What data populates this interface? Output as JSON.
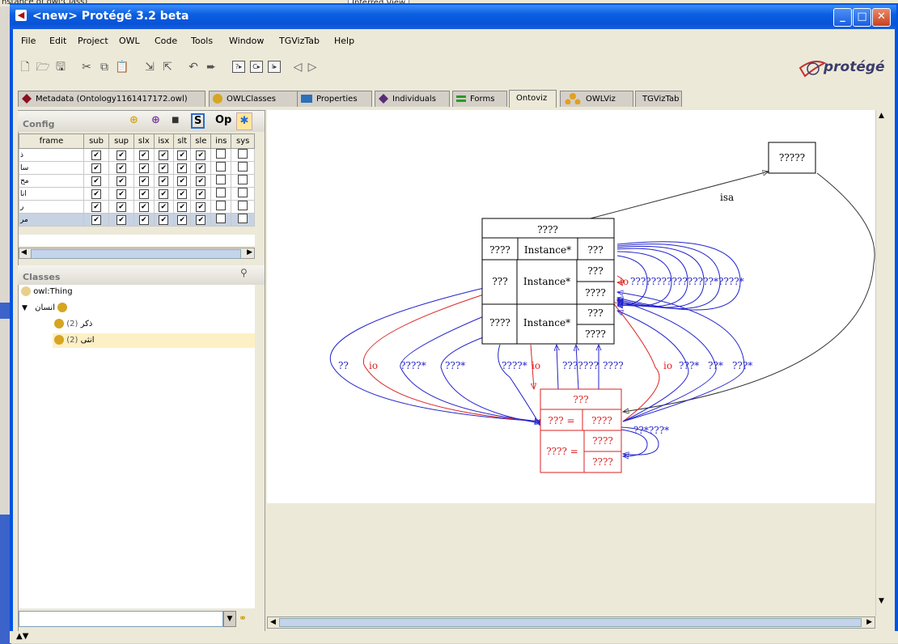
{
  "window": {
    "title": "<new>  Protégé 3.2 beta"
  },
  "background": {
    "left_text": "nstance of owl:Class)",
    "right_text": "Inferred View"
  },
  "menu": [
    "File",
    "Edit",
    "Project",
    "OWL",
    "Code",
    "Tools",
    "Window",
    "TGVizTab",
    "Help"
  ],
  "logo": {
    "text": "protégé"
  },
  "tabs": [
    {
      "label": "Metadata (Ontology1161417172.owl)",
      "icon": "diamond-dark-red"
    },
    {
      "label": "OWLClasses",
      "icon": "circle-gold"
    },
    {
      "label": "Properties",
      "icon": "rect-blue"
    },
    {
      "label": "Individuals",
      "icon": "diamond-purple"
    },
    {
      "label": "Forms",
      "icon": "forms-green"
    },
    {
      "label": "Ontoviz",
      "icon": ""
    },
    {
      "label": "OWLViz",
      "icon": "tree-gold"
    },
    {
      "label": "TGVizTab",
      "icon": ""
    }
  ],
  "config": {
    "title": "Config",
    "header_icons": [
      "S",
      "Op"
    ],
    "columns": [
      "frame",
      "sub",
      "sup",
      "slx",
      "isx",
      "slt",
      "sle",
      "ins",
      "sys"
    ],
    "rows": [
      {
        "frame": "ذ",
        "checks": [
          true,
          true,
          true,
          true,
          true,
          true,
          false,
          false
        ]
      },
      {
        "frame": "سا",
        "checks": [
          true,
          true,
          true,
          true,
          true,
          true,
          false,
          false
        ]
      },
      {
        "frame": "مح",
        "checks": [
          true,
          true,
          true,
          true,
          true,
          true,
          false,
          false
        ]
      },
      {
        "frame": "انا",
        "checks": [
          true,
          true,
          true,
          true,
          true,
          true,
          false,
          false
        ]
      },
      {
        "frame": "ر",
        "checks": [
          true,
          true,
          true,
          true,
          true,
          true,
          false,
          false
        ]
      },
      {
        "frame": "مر",
        "checks": [
          true,
          true,
          true,
          true,
          true,
          true,
          false,
          false
        ]
      }
    ]
  },
  "classes": {
    "title": "Classes",
    "tree": [
      {
        "label": "owl:Thing",
        "count": ""
      },
      {
        "label": "انسان",
        "count": ""
      },
      {
        "label": "ذکر",
        "count": "(2)"
      },
      {
        "label": "انثی",
        "count": "(2)"
      }
    ]
  },
  "graph": {
    "top_node": "?????",
    "isa_label": "isa",
    "big_node": {
      "title": "????",
      "row1": [
        "????",
        "Instance*",
        "???"
      ],
      "row2": [
        "???",
        "Instance*",
        "???",
        "????"
      ],
      "row3": [
        "????",
        "Instance*",
        "???",
        "????"
      ]
    },
    "red_node": {
      "title": "???",
      "row1": [
        "??? =",
        "????"
      ],
      "row2": [
        "???? =",
        "????",
        "????"
      ]
    },
    "right_label_io": "io",
    "right_labels": "????????????????*????*",
    "edge_labels": [
      "??",
      "io",
      "????*",
      "???*",
      "????*",
      "io",
      "???????",
      "????",
      "io",
      "???*",
      "??*",
      "???*"
    ],
    "self_loop_label": "??*???*"
  }
}
